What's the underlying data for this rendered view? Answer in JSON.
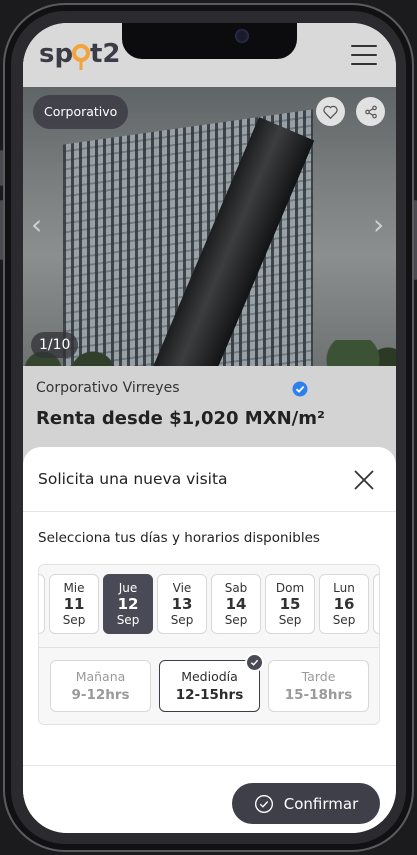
{
  "header": {
    "logo_text_a": "sp",
    "logo_text_b": "t2",
    "logo_color_main": "#3c3c46",
    "logo_color_accent": "#f3a33b"
  },
  "hero": {
    "category_chip": "Corporativo",
    "counter": "1/10"
  },
  "listing": {
    "name": "Corporativo Virreyes",
    "price": "Renta desde $1,020 MXN/m²"
  },
  "sheet": {
    "title": "Solicita una nueva visita",
    "subtitle": "Selecciona tus días y horarios disponibles",
    "days": [
      {
        "name": "Mie",
        "date": "11",
        "month": "Sep",
        "selected": false
      },
      {
        "name": "Jue",
        "date": "12",
        "month": "Sep",
        "selected": true
      },
      {
        "name": "Vie",
        "date": "13",
        "month": "Sep",
        "selected": false
      },
      {
        "name": "Sab",
        "date": "14",
        "month": "Sep",
        "selected": false
      },
      {
        "name": "Dom",
        "date": "15",
        "month": "Sep",
        "selected": false
      },
      {
        "name": "Lun",
        "date": "16",
        "month": "Sep",
        "selected": false
      }
    ],
    "slots": [
      {
        "label": "Mañana",
        "time": "9-12hrs",
        "selected": false
      },
      {
        "label": "Mediodía",
        "time": "12-15hrs",
        "selected": true
      },
      {
        "label": "Tarde",
        "time": "15-18hrs",
        "selected": false
      }
    ],
    "confirm_label": "Confirmar"
  },
  "colors": {
    "accent_dark": "#4a4a57",
    "verified_blue": "#2f80ed"
  }
}
